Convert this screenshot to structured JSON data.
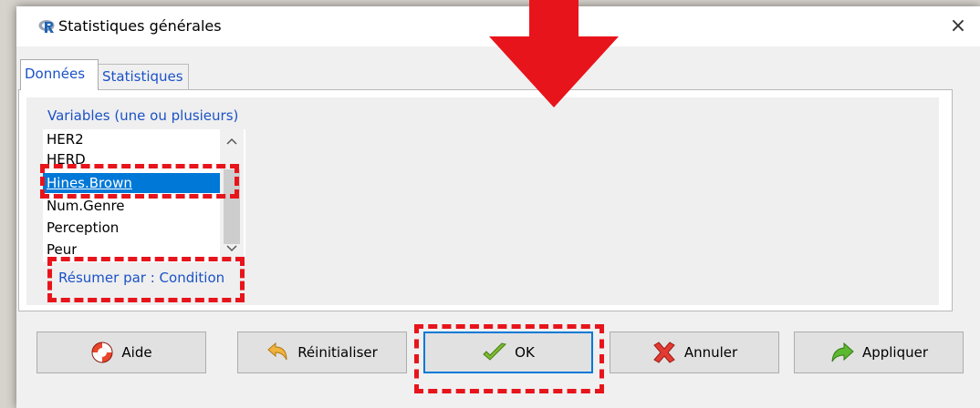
{
  "window": {
    "title": "Statistiques générales",
    "close_glyph": "×"
  },
  "tabs": [
    {
      "label": "Données",
      "active": true
    },
    {
      "label": "Statistiques",
      "active": false
    }
  ],
  "variables": {
    "label": "Variables (une ou plusieurs)",
    "items": [
      "HER2",
      "HERD",
      "Hines.Brown",
      "Num.Genre",
      "Perception",
      "Peur"
    ],
    "selected": "Hines.Brown"
  },
  "summarize": {
    "label": "Résumer par : Condition"
  },
  "buttons": {
    "help": "Aide",
    "reset": "Réinitialiser",
    "ok": "OK",
    "cancel": "Annuler",
    "apply": "Appliquer"
  },
  "colors": {
    "annotation": "#e8141b",
    "selection": "#0078d7",
    "link_text": "#1b52c6"
  },
  "icons": [
    "r-logo-icon",
    "close-icon",
    "lifebuoy-icon",
    "undo-arrow-icon",
    "checkmark-icon",
    "cross-icon",
    "forward-arrow-icon",
    "down-arrow-annotation"
  ]
}
